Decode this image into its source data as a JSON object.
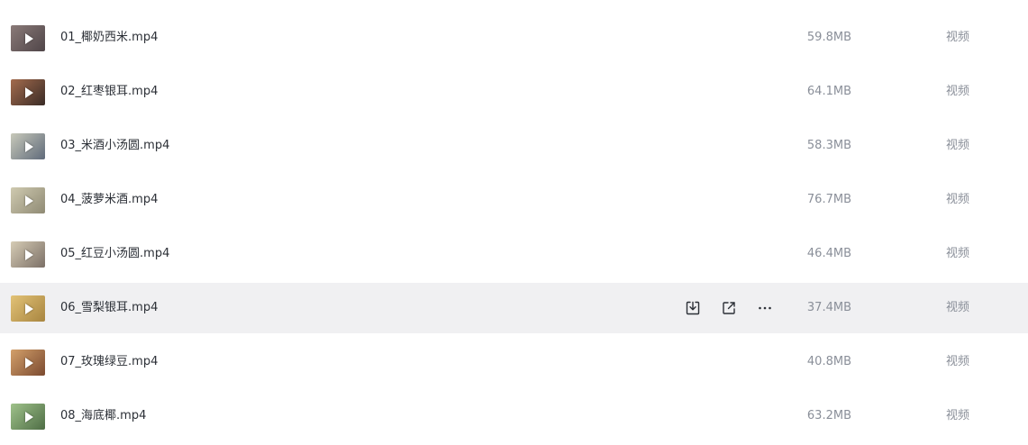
{
  "files": [
    {
      "name": "01_椰奶西米.mp4",
      "size": "59.8MB",
      "type": "视频",
      "thumb_colors": [
        "#8a7a78",
        "#4f4548"
      ]
    },
    {
      "name": "02_红枣银耳.mp4",
      "size": "64.1MB",
      "type": "视频",
      "thumb_colors": [
        "#a36b4d",
        "#3a2b26"
      ]
    },
    {
      "name": "03_米酒小汤圆.mp4",
      "size": "58.3MB",
      "type": "视频",
      "thumb_colors": [
        "#c8c9ba",
        "#5f6a7a"
      ]
    },
    {
      "name": "04_菠萝米酒.mp4",
      "size": "76.7MB",
      "type": "视频",
      "thumb_colors": [
        "#cfcab0",
        "#8f8a74"
      ]
    },
    {
      "name": "05_红豆小汤圆.mp4",
      "size": "46.4MB",
      "type": "视频",
      "thumb_colors": [
        "#d6ccb5",
        "#7b6f66"
      ]
    },
    {
      "name": "06_雪梨银耳.mp4",
      "size": "37.4MB",
      "type": "视频",
      "thumb_colors": [
        "#e2c276",
        "#a88540"
      ]
    },
    {
      "name": "07_玫瑰绿豆.mp4",
      "size": "40.8MB",
      "type": "视频",
      "thumb_colors": [
        "#d3a06a",
        "#7b4a30"
      ]
    },
    {
      "name": "08_海底椰.mp4",
      "size": "63.2MB",
      "type": "视频",
      "thumb_colors": [
        "#9fc28a",
        "#4e6d45"
      ]
    }
  ],
  "hover_actions": [
    {
      "name": "download-icon"
    },
    {
      "name": "share-icon"
    },
    {
      "name": "more-icon"
    }
  ],
  "hovered_index": 5,
  "colors": {
    "hover_bg": "#f0f0f2",
    "name_text": "#2b2f36",
    "meta_text": "#8a8f99"
  }
}
